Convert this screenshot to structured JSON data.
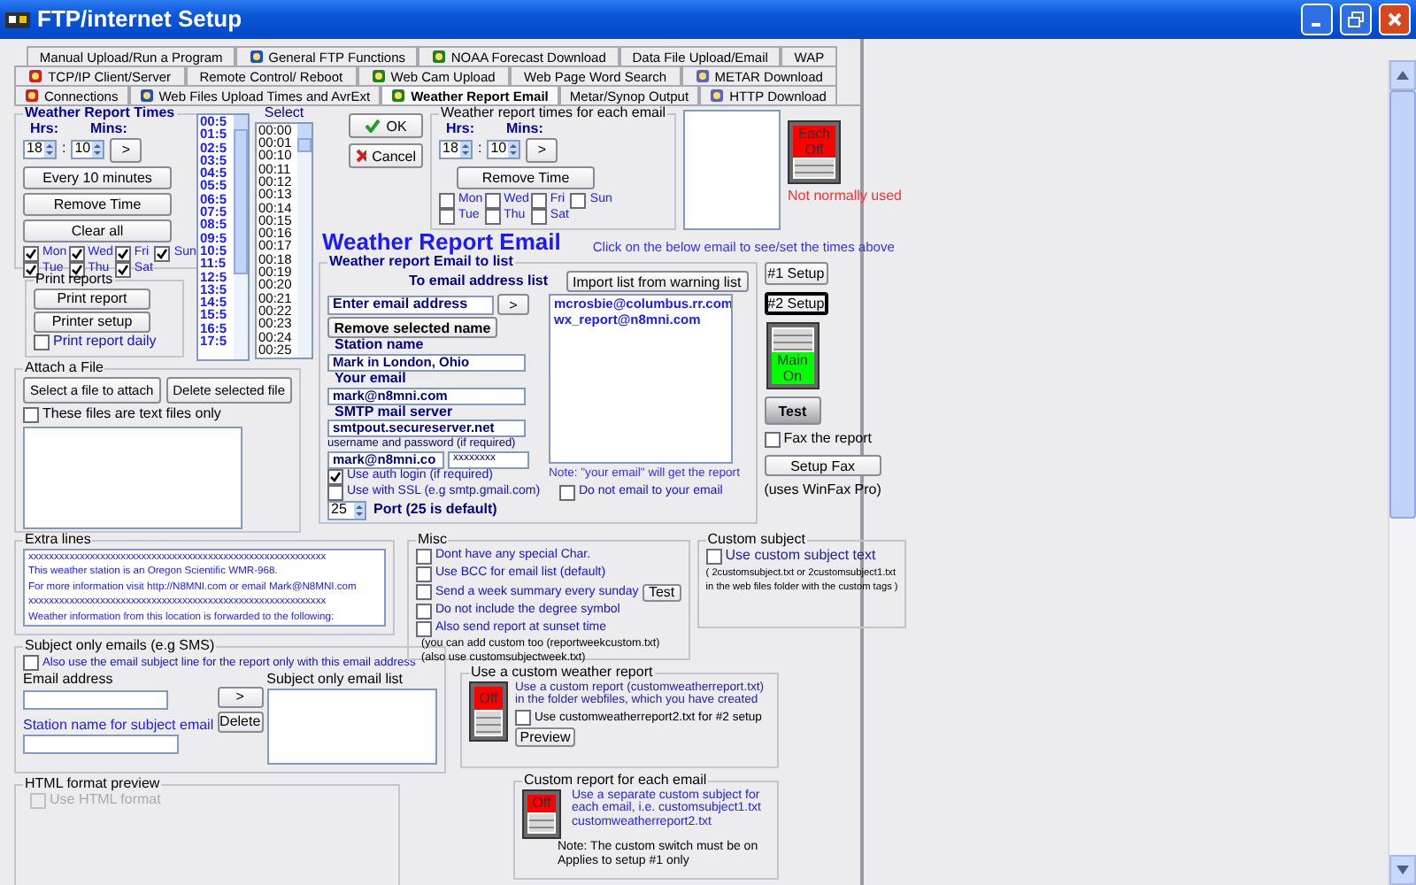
{
  "window": {
    "title": "FTP/internet Setup"
  },
  "tab_rows": [
    [
      {
        "label": "Manual Upload/Run a Program",
        "icon": false,
        "selected": false
      },
      {
        "label": "General FTP Functions",
        "icon": true,
        "selected": false
      },
      {
        "label": "NOAA Forecast Download",
        "icon": true,
        "selected": false
      },
      {
        "label": "Data File Upload/Email",
        "icon": false,
        "selected": false
      },
      {
        "label": "WAP",
        "icon": false,
        "selected": false
      }
    ],
    [
      {
        "label": "TCP/IP Client/Server",
        "icon": true,
        "selected": false
      },
      {
        "label": "Remote Control/ Reboot",
        "icon": false,
        "selected": false
      },
      {
        "label": "Web Cam Upload",
        "icon": true,
        "selected": false
      },
      {
        "label": "Web Page Word Search",
        "icon": false,
        "selected": false
      },
      {
        "label": "METAR Download",
        "icon": true,
        "selected": false
      }
    ],
    [
      {
        "label": "Connections",
        "icon": true,
        "selected": false
      },
      {
        "label": "Web Files Upload Times and AvrExt",
        "icon": true,
        "selected": false
      },
      {
        "label": "Weather Report Email",
        "icon": true,
        "selected": true
      },
      {
        "label": "Metar/Synop Output",
        "icon": false,
        "selected": false
      },
      {
        "label": "HTTP Download",
        "icon": true,
        "selected": false
      }
    ]
  ],
  "report_times": {
    "title": "Weather Report Times",
    "hours_label": "Hrs:",
    "mins_label": "Mins:",
    "hours": "18",
    "separator": ":",
    "mins": "10",
    "add_button": ">",
    "buttons": [
      "Every 10 minutes",
      "Remove Time",
      "Clear all"
    ],
    "days": [
      {
        "label": "Mon",
        "checked": true
      },
      {
        "label": "Wed",
        "checked": true
      },
      {
        "label": "Fri",
        "checked": true
      },
      {
        "label": "Sun",
        "checked": true
      },
      {
        "label": "Tue",
        "checked": true
      },
      {
        "label": "Thu",
        "checked": true
      },
      {
        "label": "Sat",
        "checked": true
      }
    ]
  },
  "time_list": [
    "00:5",
    "01:5",
    "02:5",
    "03:5",
    "04:5",
    "05:5",
    "06:5",
    "07:5",
    "08:5",
    "09:5",
    "10:5",
    "11:5",
    "12:5",
    "13:5",
    "14:5",
    "15:5",
    "16:5",
    "17:5"
  ],
  "select_label": "Select",
  "minute_list": [
    "00:00",
    "00:01",
    "00:10",
    "00:11",
    "00:12",
    "00:13",
    "00:14",
    "00:15",
    "00:16",
    "00:17",
    "00:18",
    "00:19",
    "00:20",
    "00:21",
    "00:22",
    "00:23",
    "00:24",
    "00:25"
  ],
  "print_reports": {
    "title": "Print reports",
    "buttons": [
      "Print report",
      "Printer setup"
    ],
    "daily": {
      "label": "Print report daily",
      "checked": false
    }
  },
  "attach": {
    "title": "Attach a File",
    "buttons": [
      "Select a file to attach",
      "Delete selected file"
    ],
    "text_only": {
      "label": "These files are text files only",
      "checked": false
    }
  },
  "dialog_buttons": [
    {
      "label": "OK",
      "kind": "ok"
    },
    {
      "label": "Cancel",
      "kind": "cancel"
    }
  ],
  "times_each_email": {
    "title": "Weather report times for each email",
    "hours_label": "Hrs:",
    "mins_label": "Mins:",
    "hours": "18",
    "separator": ":",
    "mins": "10",
    "add_button": ">",
    "remove_button": "Remove Time",
    "days": [
      {
        "label": "Mon",
        "checked": false
      },
      {
        "label": "Wed",
        "checked": false
      },
      {
        "label": "Fri",
        "checked": false
      },
      {
        "label": "Sun",
        "checked": false
      },
      {
        "label": "Tue",
        "checked": false
      },
      {
        "label": "Thu",
        "checked": false
      },
      {
        "label": "Sat",
        "checked": false
      }
    ]
  },
  "each_switch": {
    "label": "Each Off",
    "on": false,
    "note": "Not normally used"
  },
  "heading": "Weather Report Email",
  "hint": "Click on the below email to see/set the times above",
  "email_group": {
    "title": "Weather report Email to list",
    "list_title": "To email address list",
    "import_button": "Import list from warning list",
    "address": "Enter email address",
    "add_button": ">",
    "remove_button": "Remove selected name",
    "addresses": [
      "mcrosbie@columbus.rr.com",
      "wx_report@n8mni.com"
    ],
    "fields": [
      {
        "label": "Station name",
        "value": "Mark in London, Ohio"
      },
      {
        "label": "Your email",
        "value": "mark@n8mni.com"
      },
      {
        "label": "SMTP mail server",
        "value": "smtpout.secureserver.net"
      }
    ],
    "login_label": "username and password (if required)",
    "username": "mark@n8mni.co",
    "password": "xxxxxxxx",
    "options": [
      {
        "label": "Use auth login (if required)",
        "checked": true
      },
      {
        "label": "Use with SSL (e.g smtp.gmail.com)",
        "checked": false
      }
    ],
    "port": "25",
    "port_label": "Port (25 is default)",
    "note": "Note: \"your email\" will get the report",
    "no_self": {
      "label": "Do not email to your email",
      "checked": false
    }
  },
  "setup_buttons": [
    {
      "label": "#1 Setup",
      "selected": false
    },
    {
      "label": "#2 Setup",
      "selected": true
    }
  ],
  "main_switch": {
    "label": "Main On",
    "on": true
  },
  "test_button": "Test",
  "fax": {
    "label": "Fax the report",
    "checked": false
  },
  "fax_button": "Setup Fax",
  "fax_note": "(uses WinFax Pro)",
  "extra_lines": {
    "title": "Extra lines",
    "lines": [
      "xxxxxxxxxxxxxxxxxxxxxxxxxxxxxxxxxxxxxxxxxxxxxxxxxxxxxxxxxx",
      "This weather station is an Oregon Scientific WMR-968.",
      "For more information visit http://N8MNI.com or email Mark@N8MNI.com",
      "xxxxxxxxxxxxxxxxxxxxxxxxxxxxxxxxxxxxxxxxxxxxxxxxxxxxxxxxxx",
      "Weather information from this location is forwarded to the following:"
    ]
  },
  "misc": {
    "title": "Misc",
    "options": [
      {
        "label": "Dont have any special Char.",
        "checked": false
      },
      {
        "label": "Use BCC for email list (default)",
        "checked": false
      },
      {
        "label": "Send a week summary every sunday",
        "checked": false
      },
      {
        "label": "Do not include the degree symbol",
        "checked": false
      },
      {
        "label": "Also send report at sunset time",
        "checked": false
      }
    ],
    "test_button": "Test",
    "notes": [
      "(you can add custom too (reportweekcustom.txt)",
      "(also use customsubjectweek.txt)"
    ]
  },
  "custom_subject": {
    "title": "Custom subject",
    "option": {
      "label": "Use custom subject text",
      "checked": false
    },
    "notes": [
      "( 2customsubject.txt or 2customsubject1.txt",
      "in the web files folder with the custom tags )"
    ]
  },
  "subject_only": {
    "title": "Subject only emails (e.g SMS)",
    "option": {
      "label": "Also use the email subject line for the report only with this email address",
      "checked": false
    },
    "address_label": "Email address",
    "list_label": "Subject only email list",
    "add_button": ">",
    "delete_button": "Delete",
    "station_label": "Station name for subject email"
  },
  "html_preview": {
    "title": "HTML format preview",
    "option": {
      "label": "Use HTML format",
      "checked": false,
      "disabled": true
    }
  },
  "custom_report": {
    "title": "Use a custom weather report",
    "switch": {
      "label": "Off",
      "on": false
    },
    "text": "Use a custom report (customweatherreport.txt) in the folder webfiles, which you have created",
    "option": {
      "label": "Use customweatherreport2.txt for #2 setup",
      "checked": false
    },
    "preview_button": "Preview"
  },
  "each_report": {
    "title": "Custom report for each email",
    "switch": {
      "label": "Off",
      "on": false
    },
    "text": "Use a separate custom subject for each email, i.e. customsubject1.txt customweatherreport2.txt",
    "notes": [
      "Note: The custom switch must be on",
      "Applies to setup #1 only"
    ]
  }
}
